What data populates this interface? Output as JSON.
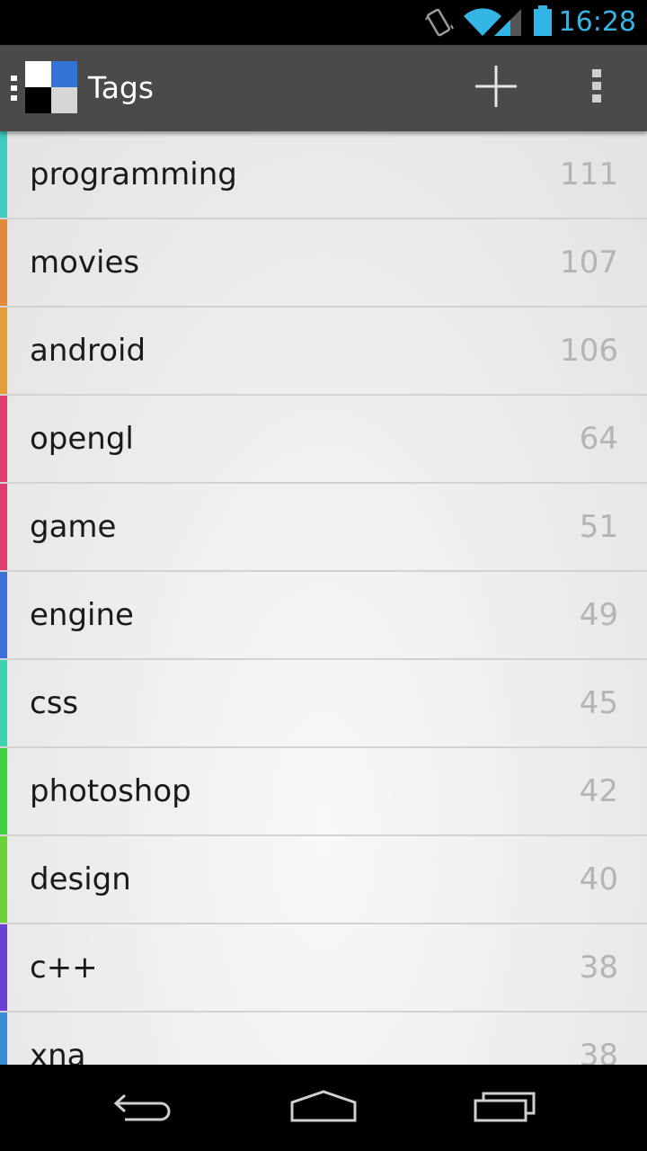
{
  "status_bar": {
    "time": "16:28",
    "icons": [
      "vibrate-icon",
      "wifi-icon",
      "cell-signal-icon",
      "battery-icon"
    ],
    "accent_color": "#33b5e5"
  },
  "action_bar": {
    "title": "Tags",
    "background": "#4a4a4a",
    "actions": [
      "add-icon",
      "overflow-menu-icon"
    ]
  },
  "tags": [
    {
      "name": "programming",
      "count": "111",
      "color": "#3fc9c0"
    },
    {
      "name": "movies",
      "count": "107",
      "color": "#e08a3c"
    },
    {
      "name": "android",
      "count": "106",
      "color": "#e3a03a"
    },
    {
      "name": "opengl",
      "count": "64",
      "color": "#dc3d6a"
    },
    {
      "name": "game",
      "count": "51",
      "color": "#dc3d6a"
    },
    {
      "name": "engine",
      "count": "49",
      "color": "#3d6fd6"
    },
    {
      "name": "css",
      "count": "45",
      "color": "#3fd1b0"
    },
    {
      "name": "photoshop",
      "count": "42",
      "color": "#3ed23c"
    },
    {
      "name": "design",
      "count": "40",
      "color": "#6fd13a"
    },
    {
      "name": "c++",
      "count": "38",
      "color": "#6a3fd4"
    },
    {
      "name": "xna",
      "count": "38",
      "color": "#3a8ad6"
    }
  ],
  "nav_bar": {
    "buttons": [
      "back-icon",
      "home-icon",
      "recent-apps-icon"
    ]
  }
}
